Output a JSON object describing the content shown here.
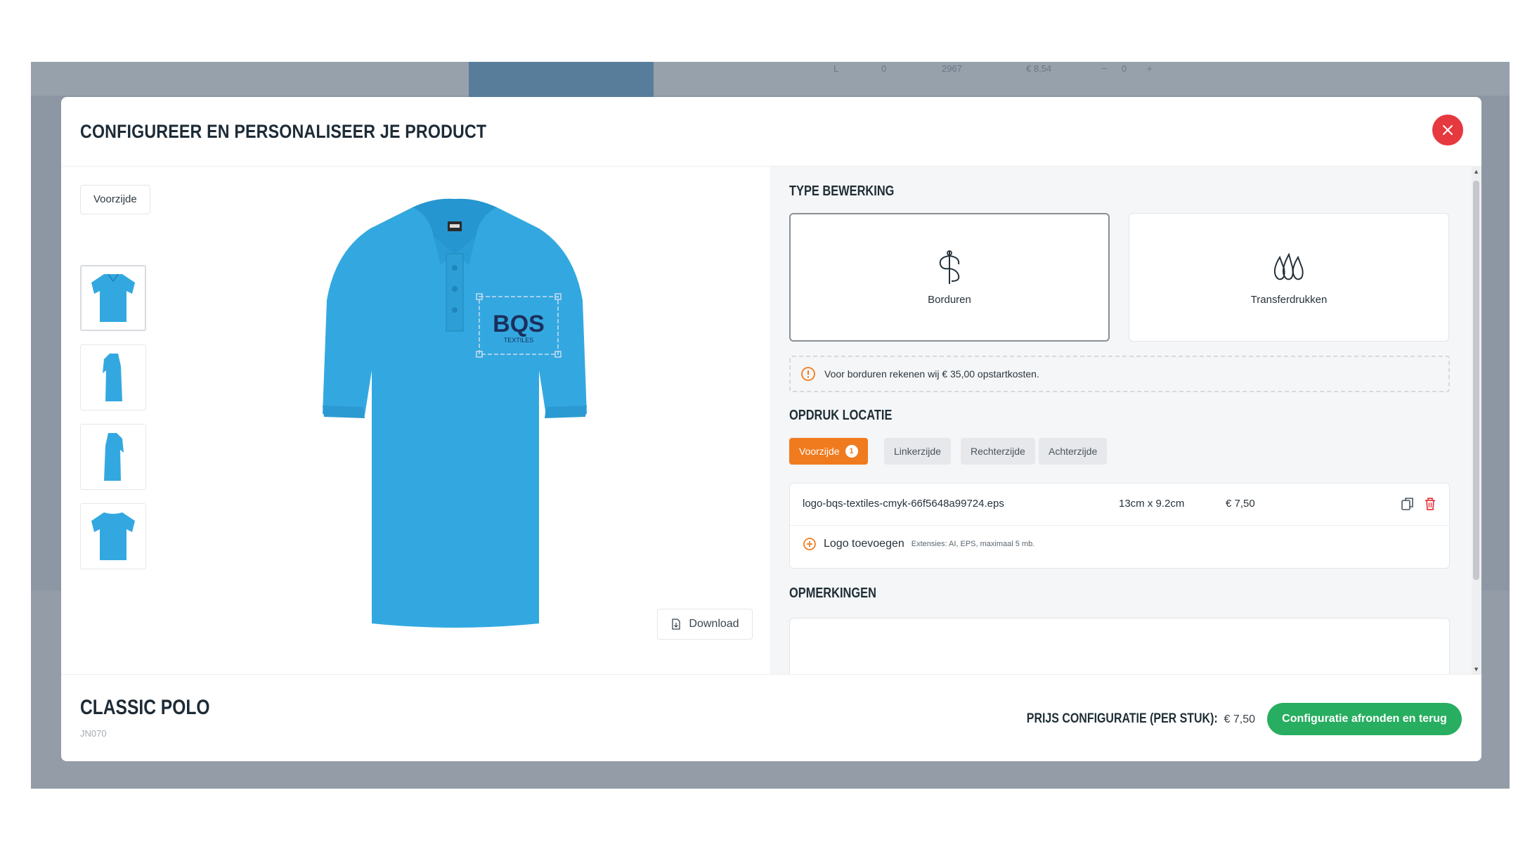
{
  "background": {
    "row_values": [
      "L",
      "0",
      "2967",
      "€ 8,54",
      "−",
      "0",
      "+"
    ]
  },
  "modal": {
    "title": "CONFIGUREER EN PERSONALISEER JE PRODUCT",
    "close_icon": "close-icon"
  },
  "preview": {
    "side_label": "Voorzijde",
    "thumbnails": [
      "polo-front",
      "polo-left-side",
      "polo-right-side",
      "polo-back"
    ],
    "product_color": "#33a8e0",
    "logo_text": "BQS",
    "logo_subtext": "TEXTILES",
    "download_label": "Download"
  },
  "config": {
    "type_title": "TYPE BEWERKING",
    "types": [
      {
        "label": "Borduren",
        "icon": "embroidery-icon",
        "selected": true
      },
      {
        "label": "Transferdrukken",
        "icon": "transfer-print-icon",
        "selected": false
      }
    ],
    "notice": "Voor borduren rekenen wij € 35,00 opstartkosten.",
    "location_title": "OPDRUK LOCATIE",
    "locations": [
      {
        "label": "Voorzijde",
        "badge": "1",
        "active": true
      },
      {
        "label": "Linkerzijde",
        "active": false
      },
      {
        "label": "Rechterzijde",
        "active": false
      },
      {
        "label": "Achterzijde",
        "active": false
      }
    ],
    "file": {
      "name": "logo-bqs-textiles-cmyk-66f5648a99724.eps",
      "size": "13cm x 9.2cm",
      "price": "€ 7,50"
    },
    "add_logo_label": "Logo toevoegen",
    "add_logo_hint": "Extensies: AI, EPS, maximaal 5 mb.",
    "remarks_title": "OPMERKINGEN"
  },
  "footer": {
    "product_name": "CLASSIC POLO",
    "product_code": "JN070",
    "price_label": "PRIJS CONFIGURATIE (PER STUK):",
    "price_value": "€ 7,50",
    "finish_label": "Configuratie afronden en terug"
  },
  "colors": {
    "accent_orange": "#f07b1f",
    "accent_green": "#27ae60",
    "close_red": "#e5393f"
  }
}
